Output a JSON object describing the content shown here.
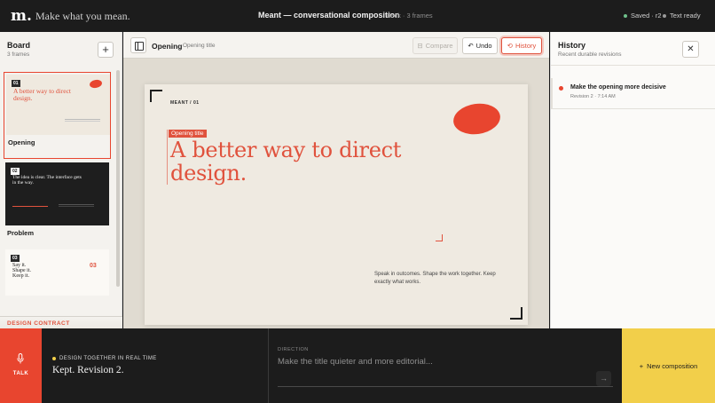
{
  "topbar": {
    "logo": "m.",
    "tagline": "Make what you mean.",
    "title": "Meant — conversational composition",
    "subtitle": "deck · 3 frames",
    "saved_status": "Saved · r2",
    "text_status": "Text ready"
  },
  "sidebar": {
    "title": "Board",
    "subtitle": "3 frames",
    "add_icon": "+",
    "frames": [
      {
        "num": "01",
        "label": "Opening",
        "thumb_text": "A better way to direct design."
      },
      {
        "num": "02",
        "label": "Problem",
        "thumb_text": "The idea is clear. The interface gets in the way."
      },
      {
        "num": "03",
        "label": "",
        "thumb_text": "Say it. Shape it. Keep it.",
        "big": "03"
      }
    ],
    "contract_label": "DESIGN CONTRACT"
  },
  "toolbar": {
    "frame_name": "Opening",
    "frame_role": "Opening title",
    "compare_label": "Compare",
    "undo_label": "Undo",
    "history_label": "History"
  },
  "slide": {
    "eyebrow": "MEANT / 01",
    "selection_tag": "Opening title",
    "headline": "A better way to direct design.",
    "body": "Speak in outcomes. Shape the work together. Keep exactly what works."
  },
  "history": {
    "title": "History",
    "subtitle": "Recent durable revisions",
    "close_icon": "✕",
    "items": [
      {
        "title": "Make the opening more decisive",
        "meta": "Revision 2 · 7:14 AM"
      }
    ]
  },
  "bottom": {
    "talk_label": "TALK",
    "live_label": "DESIGN TOGETHER IN REAL TIME",
    "live_message": "Kept. Revision 2.",
    "direction_label": "DIRECTION",
    "direction_placeholder": "Make the title quieter and more editorial...",
    "send_icon": "→",
    "new_composition_label": "New composition",
    "new_icon": "+"
  },
  "colors": {
    "accent": "#e8452f",
    "dark": "#1c1c1c",
    "yellow": "#f2cf4a",
    "saved_dot": "#6fc08b"
  }
}
